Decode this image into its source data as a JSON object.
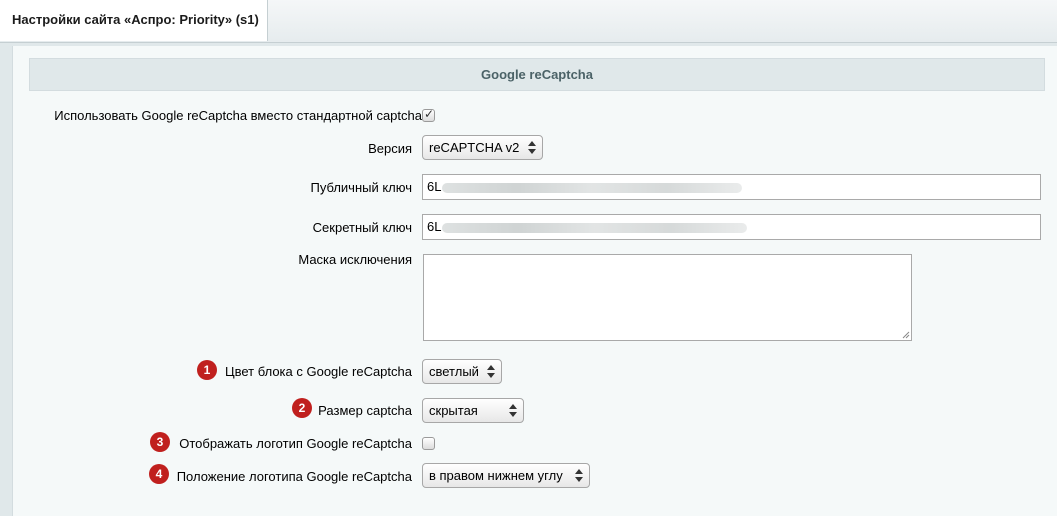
{
  "tab": {
    "title": "Настройки сайта «Аспро: Priority» (s1)"
  },
  "section": {
    "title": "Google reCaptcha"
  },
  "fields": {
    "use_recaptcha": {
      "label": "Использовать Google reCaptcha вместо стандартной captcha",
      "checked": true
    },
    "version": {
      "label": "Версия",
      "value": "reCAPTCHA v2"
    },
    "public_key": {
      "label": "Публичный ключ",
      "value": "6L"
    },
    "secret_key": {
      "label": "Секретный ключ",
      "value": "6L"
    },
    "exclusion_mask": {
      "label": "Маска исключения",
      "value": ""
    },
    "block_color": {
      "label": "Цвет блока с Google reCaptcha",
      "value": "светлый",
      "badge": "1"
    },
    "captcha_size": {
      "label": "Размер captcha",
      "value": "скрытая",
      "badge": "2"
    },
    "show_logo": {
      "label": "Отображать логотип Google reCaptcha",
      "checked": false,
      "badge": "3"
    },
    "logo_position": {
      "label": "Положение логотипа Google reCaptcha",
      "value": "в правом нижнем углу",
      "badge": "4"
    }
  },
  "colors": {
    "badge": "#c0201e",
    "section_title": "#4b6267"
  }
}
